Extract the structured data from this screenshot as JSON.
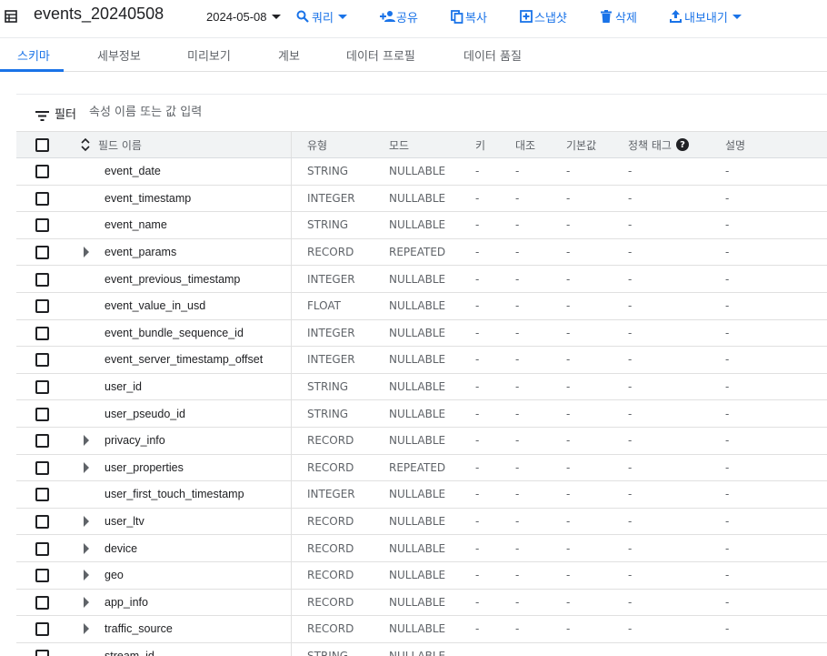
{
  "header": {
    "title": "events_20240508",
    "date_selector": "2024-05-08",
    "actions": {
      "query": "쿼리",
      "share": "공유",
      "copy": "복사",
      "snapshot": "스냅샷",
      "delete": "삭제",
      "export": "내보내기"
    }
  },
  "tabs": [
    "스키마",
    "세부정보",
    "미리보기",
    "계보",
    "데이터 프로필",
    "데이터 품질"
  ],
  "filter": {
    "label": "필터",
    "placeholder": "속성 이름 또는 값 입력"
  },
  "table": {
    "columns": {
      "name": "필드 이름",
      "type": "유형",
      "mode": "모드",
      "key": "키",
      "collation": "대조",
      "default": "기본값",
      "policy_tags": "정책 태그",
      "description": "설명"
    },
    "rows": [
      {
        "name": "event_date",
        "type": "STRING",
        "mode": "NULLABLE",
        "key": "-",
        "collation": "-",
        "default": "-",
        "policy": "-",
        "desc": "-"
      },
      {
        "name": "event_timestamp",
        "type": "INTEGER",
        "mode": "NULLABLE",
        "key": "-",
        "collation": "-",
        "default": "-",
        "policy": "-",
        "desc": "-"
      },
      {
        "name": "event_name",
        "type": "STRING",
        "mode": "NULLABLE",
        "key": "-",
        "collation": "-",
        "default": "-",
        "policy": "-",
        "desc": "-"
      },
      {
        "name": "event_params",
        "type": "RECORD",
        "mode": "REPEATED",
        "key": "-",
        "collation": "-",
        "default": "-",
        "policy": "-",
        "desc": "-"
      },
      {
        "name": "event_previous_timestamp",
        "type": "INTEGER",
        "mode": "NULLABLE",
        "key": "-",
        "collation": "-",
        "default": "-",
        "policy": "-",
        "desc": "-"
      },
      {
        "name": "event_value_in_usd",
        "type": "FLOAT",
        "mode": "NULLABLE",
        "key": "-",
        "collation": "-",
        "default": "-",
        "policy": "-",
        "desc": "-"
      },
      {
        "name": "event_bundle_sequence_id",
        "type": "INTEGER",
        "mode": "NULLABLE",
        "key": "-",
        "collation": "-",
        "default": "-",
        "policy": "-",
        "desc": "-"
      },
      {
        "name": "event_server_timestamp_offset",
        "type": "INTEGER",
        "mode": "NULLABLE",
        "key": "-",
        "collation": "-",
        "default": "-",
        "policy": "-",
        "desc": "-"
      },
      {
        "name": "user_id",
        "type": "STRING",
        "mode": "NULLABLE",
        "key": "-",
        "collation": "-",
        "default": "-",
        "policy": "-",
        "desc": "-"
      },
      {
        "name": "user_pseudo_id",
        "type": "STRING",
        "mode": "NULLABLE",
        "key": "-",
        "collation": "-",
        "default": "-",
        "policy": "-",
        "desc": "-"
      },
      {
        "name": "privacy_info",
        "type": "RECORD",
        "mode": "NULLABLE",
        "key": "-",
        "collation": "-",
        "default": "-",
        "policy": "-",
        "desc": "-"
      },
      {
        "name": "user_properties",
        "type": "RECORD",
        "mode": "REPEATED",
        "key": "-",
        "collation": "-",
        "default": "-",
        "policy": "-",
        "desc": "-"
      },
      {
        "name": "user_first_touch_timestamp",
        "type": "INTEGER",
        "mode": "NULLABLE",
        "key": "-",
        "collation": "-",
        "default": "-",
        "policy": "-",
        "desc": "-"
      },
      {
        "name": "user_ltv",
        "type": "RECORD",
        "mode": "NULLABLE",
        "key": "-",
        "collation": "-",
        "default": "-",
        "policy": "-",
        "desc": "-"
      },
      {
        "name": "device",
        "type": "RECORD",
        "mode": "NULLABLE",
        "key": "-",
        "collation": "-",
        "default": "-",
        "policy": "-",
        "desc": "-"
      },
      {
        "name": "geo",
        "type": "RECORD",
        "mode": "NULLABLE",
        "key": "-",
        "collation": "-",
        "default": "-",
        "policy": "-",
        "desc": "-"
      },
      {
        "name": "app_info",
        "type": "RECORD",
        "mode": "NULLABLE",
        "key": "-",
        "collation": "-",
        "default": "-",
        "policy": "-",
        "desc": "-"
      },
      {
        "name": "traffic_source",
        "type": "RECORD",
        "mode": "NULLABLE",
        "key": "-",
        "collation": "-",
        "default": "-",
        "policy": "-",
        "desc": "-"
      },
      {
        "name": "stream_id",
        "type": "STRING",
        "mode": "NULLABLE",
        "key": "-",
        "collation": "-",
        "default": "-",
        "policy": "-",
        "desc": "-"
      }
    ]
  },
  "colors": {
    "accent": "#1a73e8",
    "text": "#202124",
    "muted": "#5f6368",
    "header_bg": "#f1f3f4"
  }
}
